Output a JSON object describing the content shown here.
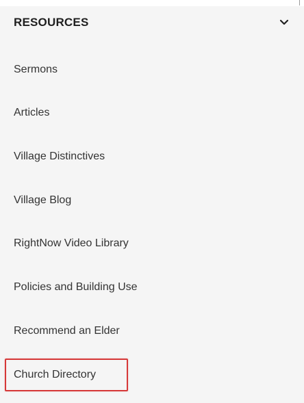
{
  "menu": {
    "title": "RESOURCES",
    "chevron_icon": "chevron-down-icon",
    "items": [
      {
        "label": "Sermons"
      },
      {
        "label": "Articles"
      },
      {
        "label": "Village Distinctives"
      },
      {
        "label": "Village Blog"
      },
      {
        "label": "RightNow Video Library"
      },
      {
        "label": "Policies and Building Use"
      },
      {
        "label": "Recommend an Elder"
      },
      {
        "label": "Church Directory"
      }
    ],
    "highlighted_item": "Church Directory",
    "highlight_color": "#d63838"
  }
}
